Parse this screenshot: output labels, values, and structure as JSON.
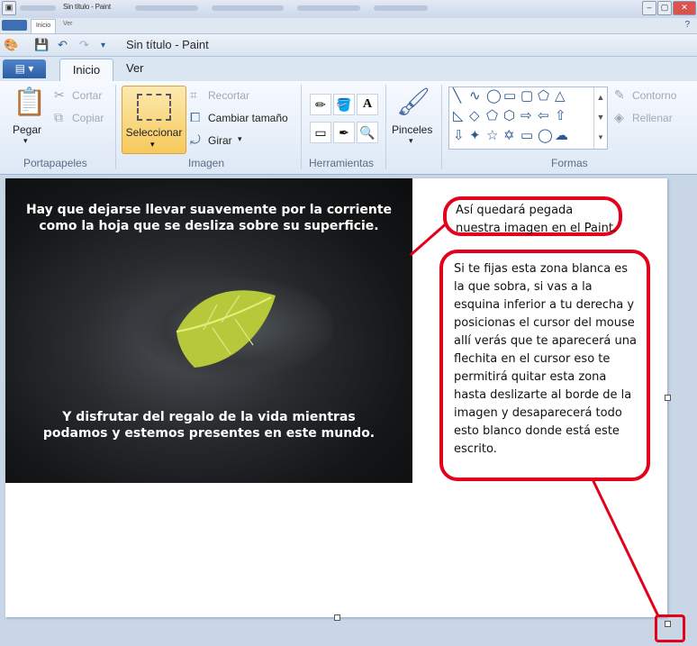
{
  "ghost": {
    "title": "Sin título - Paint",
    "tab1": "Inicio",
    "tab2": "Ver"
  },
  "window": {
    "title": "Sin título - Paint"
  },
  "tabs": {
    "menu": "▤ ▾",
    "inicio": "Inicio",
    "ver": "Ver"
  },
  "ribbon": {
    "portapapeles": {
      "label": "Portapapeles",
      "pegar": "Pegar",
      "cortar": "Cortar",
      "copiar": "Copiar"
    },
    "imagen": {
      "label": "Imagen",
      "seleccionar": "Seleccionar",
      "recortar": "Recortar",
      "cambiar": "Cambiar tamaño",
      "girar": "Girar"
    },
    "herramientas": {
      "label": "Herramientas"
    },
    "pinceles": "Pinceles",
    "formas": {
      "label": "Formas",
      "contorno": "Contorno",
      "rellenar": "Rellenar"
    }
  },
  "photo": {
    "top_text": "Hay que dejarse llevar suavemente por la corriente como la hoja que se desliza sobre su superficie.",
    "bottom_text": "Y disfrutar del regalo de la vida mientras podamos y estemos presentes en este mundo."
  },
  "callouts": {
    "c1": "Así quedará pegada nuestra imagen en el Paint.",
    "c2": "Si te fijas esta zona blanca es la que sobra, si vas a la esquina inferior a tu derecha y posicionas el cursor del mouse allí verás que te aparecerá una flechita en el cursor eso te permitirá quitar esta zona hasta deslizarte al borde de la imagen y desaparecerá todo esto blanco donde está este escrito."
  },
  "colors": {
    "accent": "#e3001b",
    "selected": "#f6c95a"
  }
}
